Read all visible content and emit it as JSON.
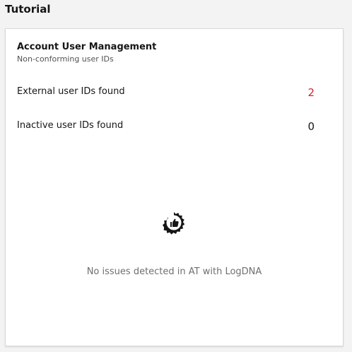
{
  "page": {
    "title": "Tutorial"
  },
  "card": {
    "title": "Account User Management",
    "subtitle": "Non-conforming user IDs",
    "metrics": [
      {
        "label": "External user IDs found",
        "value": "2",
        "status_color": "#da1e28"
      },
      {
        "label": "Inactive user IDs found",
        "value": "0",
        "status_color": "#161616"
      }
    ],
    "empty_state": {
      "icon": "thumbs-up-badge-icon",
      "message": "No issues detected in AT with LogDNA"
    }
  }
}
